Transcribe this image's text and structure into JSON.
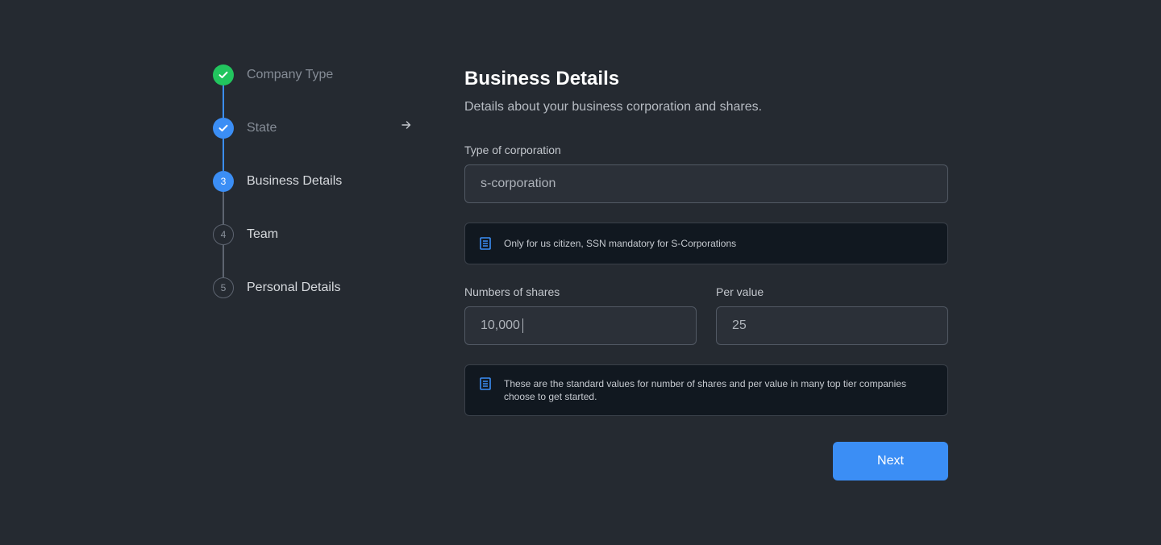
{
  "stepper": {
    "steps": [
      {
        "label": "Company Type",
        "number": "1",
        "status": "completed"
      },
      {
        "label": "State",
        "number": "2",
        "status": "completed"
      },
      {
        "label": "Business Details",
        "number": "3",
        "status": "current"
      },
      {
        "label": "Team",
        "number": "4",
        "status": "upcoming"
      },
      {
        "label": "Personal Details",
        "number": "5",
        "status": "upcoming"
      }
    ],
    "arrow_icon": "arrow-right-icon"
  },
  "form": {
    "title": "Business Details",
    "subtitle": "Details about your business corporation and shares.",
    "corporation": {
      "label": "Type of corporation",
      "value": "s-corporation"
    },
    "corporation_note": {
      "icon": "document-icon",
      "text": "Only for us citizen, SSN mandatory for S-Corporations"
    },
    "shares": {
      "label": "Numbers of shares",
      "value": "10,000"
    },
    "per_value": {
      "label": "Per value",
      "value": "25"
    },
    "shares_note": {
      "icon": "document-icon",
      "text": "These are the standard values for number of shares and per value in many top tier companies choose to get started."
    },
    "next_label": "Next"
  },
  "colors": {
    "background": "#252a31",
    "accent": "#3b8ef5",
    "success": "#22c55e",
    "info_background": "#111820"
  }
}
